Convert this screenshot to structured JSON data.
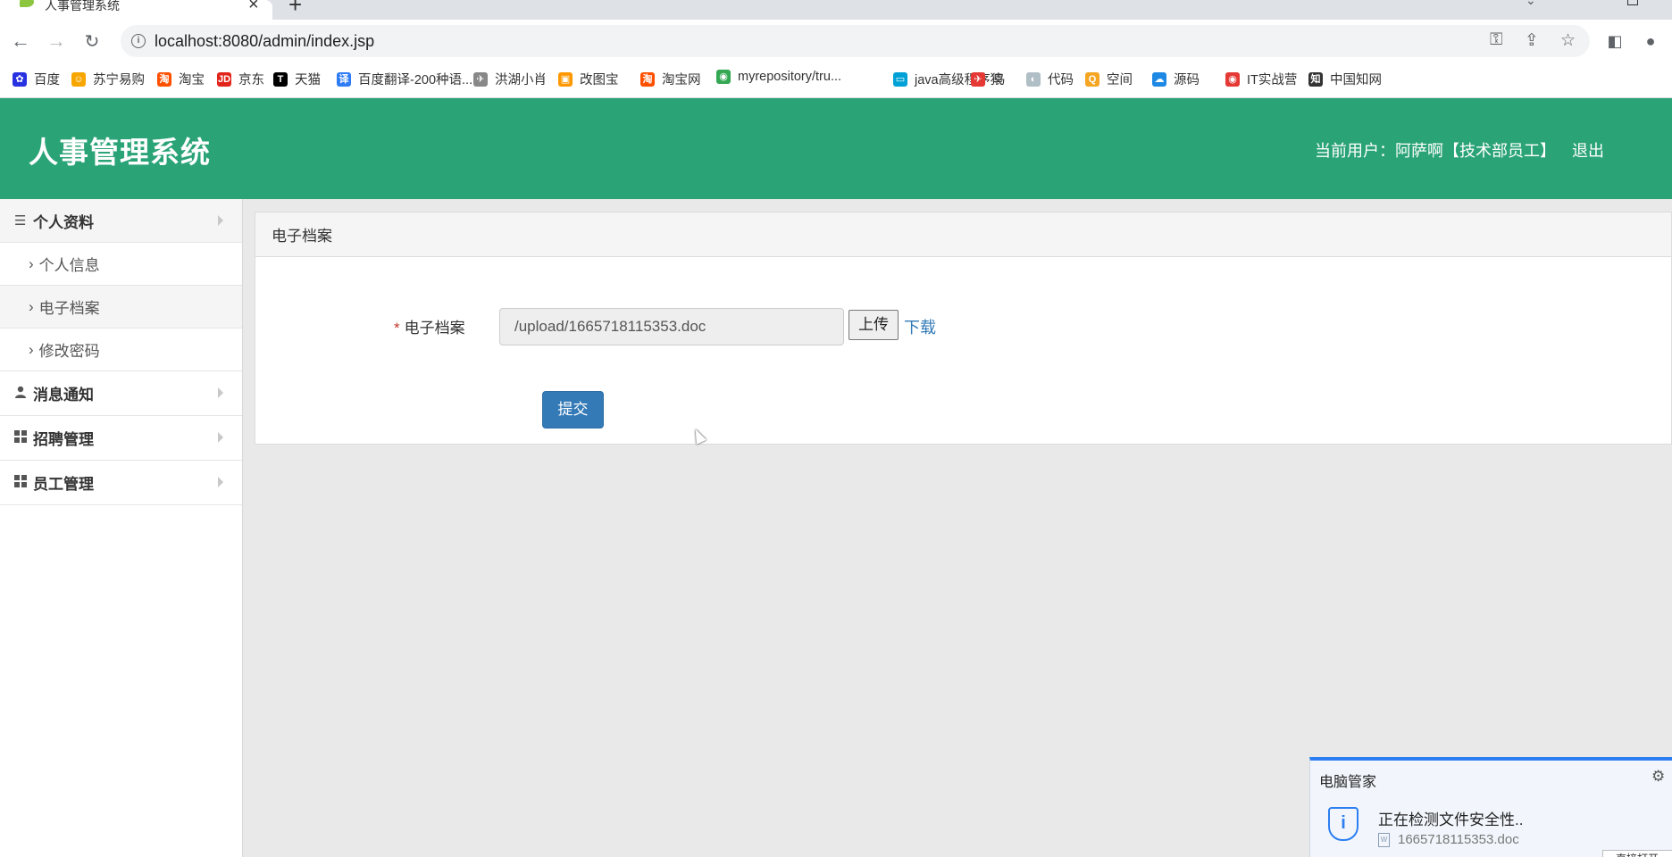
{
  "browser": {
    "tab_title": "人事管理系统",
    "url": "localhost:8080/admin/index.jsp",
    "bookmarks": [
      {
        "label": "百度",
        "icon": "baidu-icon",
        "color": "#2932e1",
        "glyph": "✿"
      },
      {
        "label": "苏宁易购",
        "icon": "suning-icon",
        "color": "#f7a600",
        "glyph": "☺"
      },
      {
        "label": "淘宝",
        "icon": "taobao-icon",
        "color": "#ff5000",
        "glyph": "淘"
      },
      {
        "label": "京东",
        "icon": "jd-icon",
        "color": "#e1251b",
        "glyph": "JD"
      },
      {
        "label": "天猫",
        "icon": "tmall-icon",
        "color": "#000000",
        "glyph": "T"
      },
      {
        "label": "百度翻译-200种语...",
        "icon": "translate-icon",
        "color": "#2f7cf6",
        "glyph": "译"
      },
      {
        "label": "洪湖小肖",
        "icon": "bird-icon",
        "color": "#888888",
        "glyph": "✈"
      },
      {
        "label": "改图宝",
        "icon": "gaitubao-icon",
        "color": "#ff9800",
        "glyph": "▣"
      },
      {
        "label": "淘宝网",
        "icon": "taobao-net-icon",
        "color": "#ff5000",
        "glyph": "淘"
      },
      {
        "label": "myrepository/tru...",
        "icon": "chrome-icon",
        "color": "#34a853",
        "glyph": "◉"
      },
      {
        "label": "java高级程序猿",
        "icon": "bilibili-icon",
        "color": "#00a1d6",
        "glyph": "▭"
      },
      {
        "label": "鸟",
        "icon": "bird-red-icon",
        "color": "#e53935",
        "glyph": "✈"
      },
      {
        "label": "代码",
        "icon": "code-icon",
        "color": "#b0bec5",
        "glyph": "◐"
      },
      {
        "label": "空间",
        "icon": "qzone-icon",
        "color": "#f5a623",
        "glyph": "Q"
      },
      {
        "label": "源码",
        "icon": "source-icon",
        "color": "#1e88e5",
        "glyph": "☁"
      },
      {
        "label": "IT实战营",
        "icon": "chrome-red-icon",
        "color": "#e53935",
        "glyph": "◉"
      },
      {
        "label": "中国知网",
        "icon": "cnki-icon",
        "color": "#333333",
        "glyph": "知"
      }
    ]
  },
  "header": {
    "title": "人事管理系统",
    "user_info": "当前用户：阿萨啊【技术部员工】",
    "logout": "退出"
  },
  "sidebar": {
    "groups": [
      {
        "label": "个人资料",
        "icon": "list-icon",
        "glyph": "☰",
        "open": true,
        "items": [
          {
            "label": "个人信息",
            "active": false
          },
          {
            "label": "电子档案",
            "active": true
          },
          {
            "label": "修改密码",
            "active": false
          }
        ]
      },
      {
        "label": "消息通知",
        "icon": "user-icon",
        "glyph": "👤",
        "open": false,
        "items": []
      },
      {
        "label": "招聘管理",
        "icon": "grid-icon",
        "glyph": "▦",
        "open": false,
        "items": []
      },
      {
        "label": "员工管理",
        "icon": "grid-icon",
        "glyph": "▦",
        "open": false,
        "items": []
      }
    ]
  },
  "panel": {
    "heading": "电子档案",
    "required_mark": "*",
    "field_label": "电子档案",
    "field_value": "/upload/1665718115353.doc",
    "upload_label": "上传",
    "download_label": "下载",
    "submit_label": "提交"
  },
  "popup": {
    "title": "电脑管家",
    "message": "正在检测文件安全性..",
    "file_name": "1665718115353.doc",
    "button_label": "直接打开"
  },
  "colors": {
    "header_bg": "#2aa377",
    "primary": "#337ab7",
    "link": "#337ab7",
    "required": "#c0392b",
    "popup_accent": "#2d7ef0"
  }
}
